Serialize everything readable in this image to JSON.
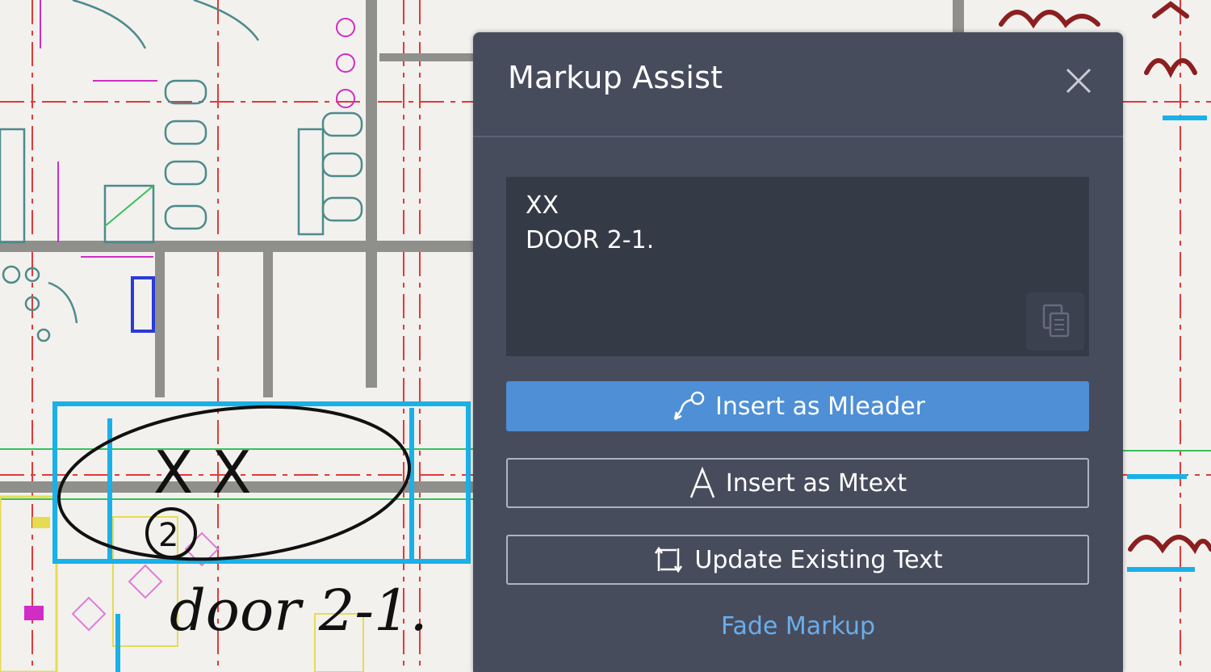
{
  "panel": {
    "title": "Markup Assist",
    "close_icon": "close-icon",
    "detected_text": "XX\nDOOR 2-1.",
    "copy_icon": "copy-icon",
    "buttons": {
      "insert_mleader": "Insert as Mleader",
      "insert_mtext": "Insert as Mtext",
      "update_text": "Update Existing Text"
    },
    "fade_markup": "Fade Markup"
  },
  "markup": {
    "handwritten_xx": "X X",
    "circled_number": "2",
    "handwritten_note": "door 2-1."
  },
  "colors": {
    "panel_bg": "#474c5d",
    "text_area_bg": "#353a47",
    "primary_button": "#4e8fd6",
    "link": "#6aaeea",
    "markup_cyan": "#1ab0e8"
  }
}
